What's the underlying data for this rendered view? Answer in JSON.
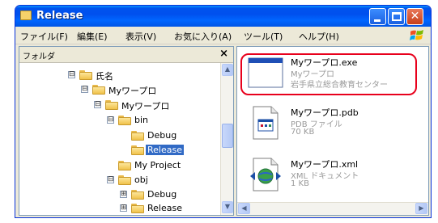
{
  "window": {
    "title": "Release",
    "colors": {
      "titlebar": "#0054e3",
      "close_button": "#d8532e",
      "selection": "#316ac5",
      "highlight_ring": "#e8001c"
    }
  },
  "menubar": {
    "items": [
      "ファイル(F)",
      "編集(E)",
      "表示(V)",
      "お気に入り(A)",
      "ツール(T)",
      "ヘルプ(H)"
    ]
  },
  "left_pane": {
    "header": "フォルダ",
    "close_glyph": "×",
    "tree": [
      {
        "label": "氏名",
        "expander": "⊟"
      },
      {
        "label": "Myワープロ",
        "expander": "⊟"
      },
      {
        "label": "Myワープロ",
        "expander": "⊟"
      },
      {
        "label": "bin",
        "expander": "⊟"
      },
      {
        "label": "Debug",
        "expander": ""
      },
      {
        "label": "Release",
        "expander": "",
        "selected": true
      },
      {
        "label": "My Project",
        "expander": ""
      },
      {
        "label": "obj",
        "expander": "⊟"
      },
      {
        "label": "Debug",
        "expander": "⊞"
      },
      {
        "label": "Release",
        "expander": "⊞"
      }
    ]
  },
  "right_pane": {
    "files": [
      {
        "name": "Myワープロ.exe",
        "line2": "Myワープロ",
        "line3": "岩手県立総合教育センター",
        "icon": "exe-window-icon",
        "highlighted": true
      },
      {
        "name": "Myワープロ.pdb",
        "line2": "PDB ファイル",
        "line3": "70 KB",
        "icon": "pdb-file-icon"
      },
      {
        "name": "Myワープロ.xml",
        "line2": "XML ドキュメント",
        "line3": "1 KB",
        "icon": "xml-file-icon"
      }
    ]
  }
}
